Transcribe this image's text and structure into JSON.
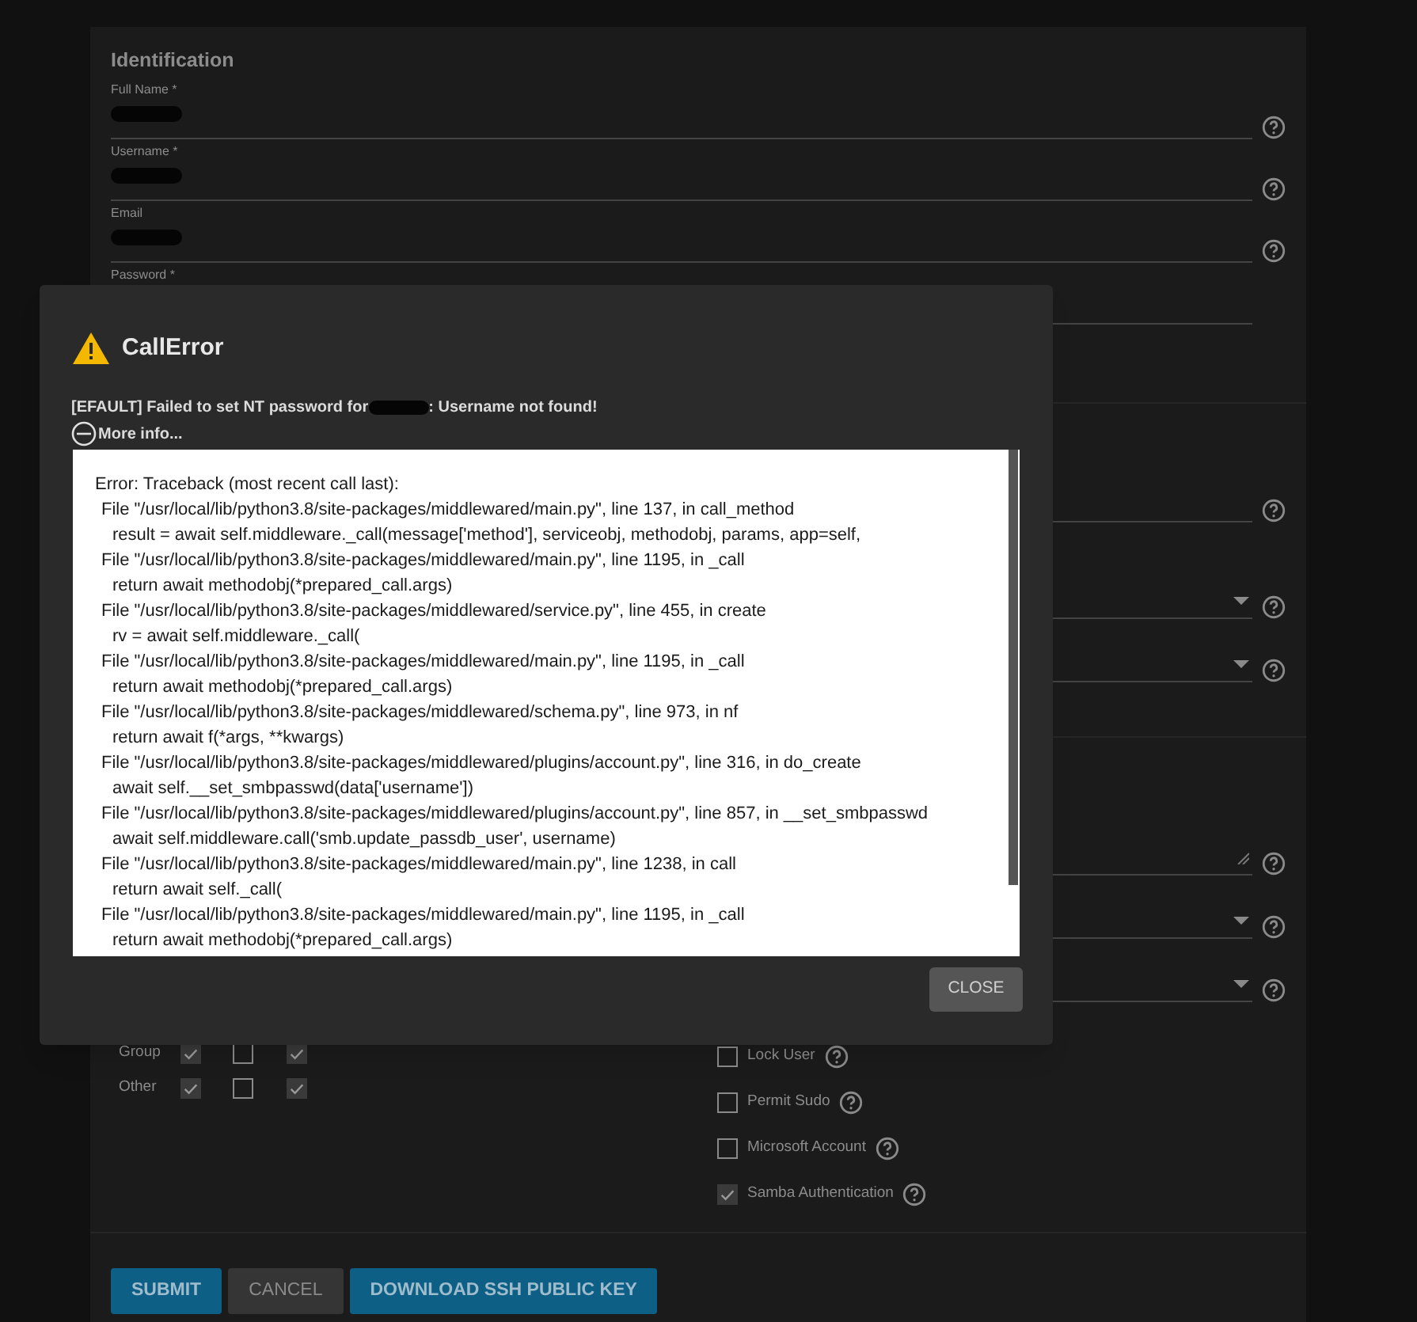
{
  "form": {
    "section_title": "Identification",
    "fields": [
      {
        "label": "Full Name *",
        "redacted": true
      },
      {
        "label": "Username *",
        "redacted": true
      },
      {
        "label": "Email",
        "redacted": true
      },
      {
        "label": "Password *",
        "redacted": false
      }
    ],
    "hidden_fields": [
      {
        "kind": "text"
      },
      {
        "kind": "select"
      },
      {
        "kind": "select"
      }
    ],
    "right_fields": [
      {
        "kind": "textarea"
      },
      {
        "kind": "select"
      },
      {
        "kind": "select"
      }
    ],
    "permissions": [
      {
        "label": "Group",
        "read": true,
        "write": false,
        "execute": true
      },
      {
        "label": "Other",
        "read": true,
        "write": false,
        "execute": true
      }
    ],
    "options": [
      {
        "label": "Lock User",
        "checked": false
      },
      {
        "label": "Permit Sudo",
        "checked": false
      },
      {
        "label": "Microsoft Account",
        "checked": false
      },
      {
        "label": "Samba Authentication",
        "checked": true
      }
    ],
    "buttons": [
      {
        "label": "SUBMIT",
        "kind": "primary"
      },
      {
        "label": "CANCEL",
        "kind": "secondary"
      },
      {
        "label": "DOWNLOAD SSH PUBLIC KEY",
        "kind": "primary"
      }
    ]
  },
  "dialog": {
    "title": "CallError",
    "message_before": "[EFAULT] Failed to set NT password for",
    "message_after": ": Username not found!",
    "more_info": "More info...",
    "traceback": [
      {
        "kind": "header",
        "text": "Error: Traceback (most recent call last):"
      },
      {
        "kind": "frame",
        "text": "File \"/usr/local/lib/python3.8/site-packages/middlewared/main.py\", line 137, in call_method"
      },
      {
        "kind": "source",
        "text": "result = await self.middleware._call(message['method'], serviceobj, methodobj, params, app=self,"
      },
      {
        "kind": "frame",
        "text": "File \"/usr/local/lib/python3.8/site-packages/middlewared/main.py\", line 1195, in _call"
      },
      {
        "kind": "source",
        "text": "return await methodobj(*prepared_call.args)"
      },
      {
        "kind": "frame",
        "text": "File \"/usr/local/lib/python3.8/site-packages/middlewared/service.py\", line 455, in create"
      },
      {
        "kind": "source",
        "text": "rv = await self.middleware._call("
      },
      {
        "kind": "frame",
        "text": "File \"/usr/local/lib/python3.8/site-packages/middlewared/main.py\", line 1195, in _call"
      },
      {
        "kind": "source",
        "text": "return await methodobj(*prepared_call.args)"
      },
      {
        "kind": "frame",
        "text": "File \"/usr/local/lib/python3.8/site-packages/middlewared/schema.py\", line 973, in nf"
      },
      {
        "kind": "source",
        "text": "return await f(*args, **kwargs)"
      },
      {
        "kind": "frame",
        "text": "File \"/usr/local/lib/python3.8/site-packages/middlewared/plugins/account.py\", line 316, in do_create"
      },
      {
        "kind": "source",
        "text": "await self.__set_smbpasswd(data['username'])"
      },
      {
        "kind": "frame",
        "text": "File \"/usr/local/lib/python3.8/site-packages/middlewared/plugins/account.py\", line 857, in __set_smbpasswd"
      },
      {
        "kind": "source",
        "text": "await self.middleware.call('smb.update_passdb_user', username)"
      },
      {
        "kind": "frame",
        "text": "File \"/usr/local/lib/python3.8/site-packages/middlewared/main.py\", line 1238, in call"
      },
      {
        "kind": "source",
        "text": "return await self._call("
      },
      {
        "kind": "frame",
        "text": "File \"/usr/local/lib/python3.8/site-packages/middlewared/main.py\", line 1195, in _call"
      },
      {
        "kind": "source",
        "text": "return await methodobj(*prepared_call.args)"
      }
    ],
    "close": "CLOSE"
  }
}
